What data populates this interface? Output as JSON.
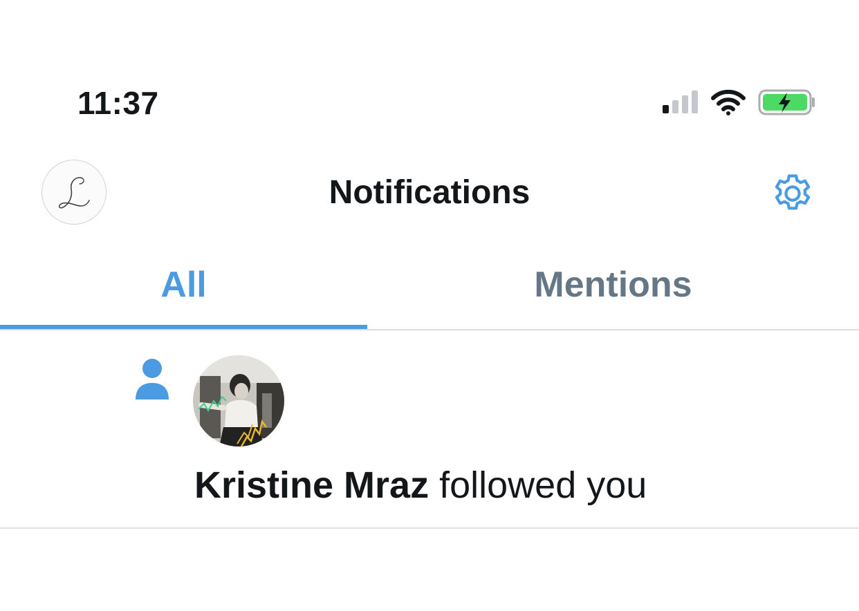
{
  "status_bar": {
    "time": "11:37",
    "icons": [
      "cellular-signal-icon",
      "wifi-icon",
      "battery-charging-icon"
    ]
  },
  "header": {
    "title": "Notifications",
    "profile_avatar_icon": "signature-l-icon",
    "settings_icon": "gear-icon"
  },
  "tabs": [
    {
      "label": "All",
      "active": true
    },
    {
      "label": "Mentions",
      "active": false
    }
  ],
  "notifications": [
    {
      "type_icon": "person-icon",
      "user_name": "Kristine Mraz",
      "action": " followed you"
    }
  ],
  "colors": {
    "accent": "#4a9be2",
    "inactive_tab": "#657786",
    "text": "#14171a",
    "divider": "#d9dde1",
    "battery_fill": "#4cd964"
  }
}
